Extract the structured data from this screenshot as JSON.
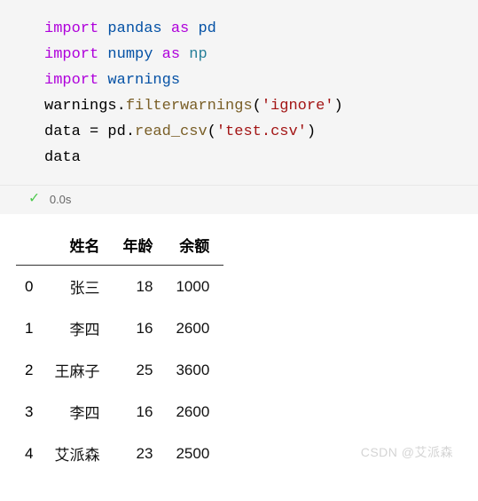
{
  "code": {
    "lines": [
      {
        "t": "import",
        "m": "pandas",
        "a": "pd",
        "dim": false
      },
      {
        "t": "import",
        "m": "numpy",
        "a": "np",
        "dim": true
      },
      {
        "t": "import_only",
        "m": "warnings"
      },
      {
        "t": "call",
        "obj": "warnings",
        "fn": "filterwarnings",
        "arg": "'ignore'"
      },
      {
        "t": "assign",
        "lhs": "data",
        "obj": "pd",
        "fn": "read_csv",
        "arg": "'test.csv'"
      },
      {
        "t": "expr",
        "v": "data"
      }
    ]
  },
  "exec": {
    "status": "ok",
    "time": "0.0s"
  },
  "chart_data": {
    "type": "table",
    "columns": [
      "姓名",
      "年龄",
      "余额"
    ],
    "index": [
      0,
      1,
      2,
      3,
      4
    ],
    "rows": [
      [
        "张三",
        18,
        1000
      ],
      [
        "李四",
        16,
        2600
      ],
      [
        "王麻子",
        25,
        3600
      ],
      [
        "李四",
        16,
        2600
      ],
      [
        "艾派森",
        23,
        2500
      ]
    ]
  },
  "watermark": "CSDN @艾派森"
}
